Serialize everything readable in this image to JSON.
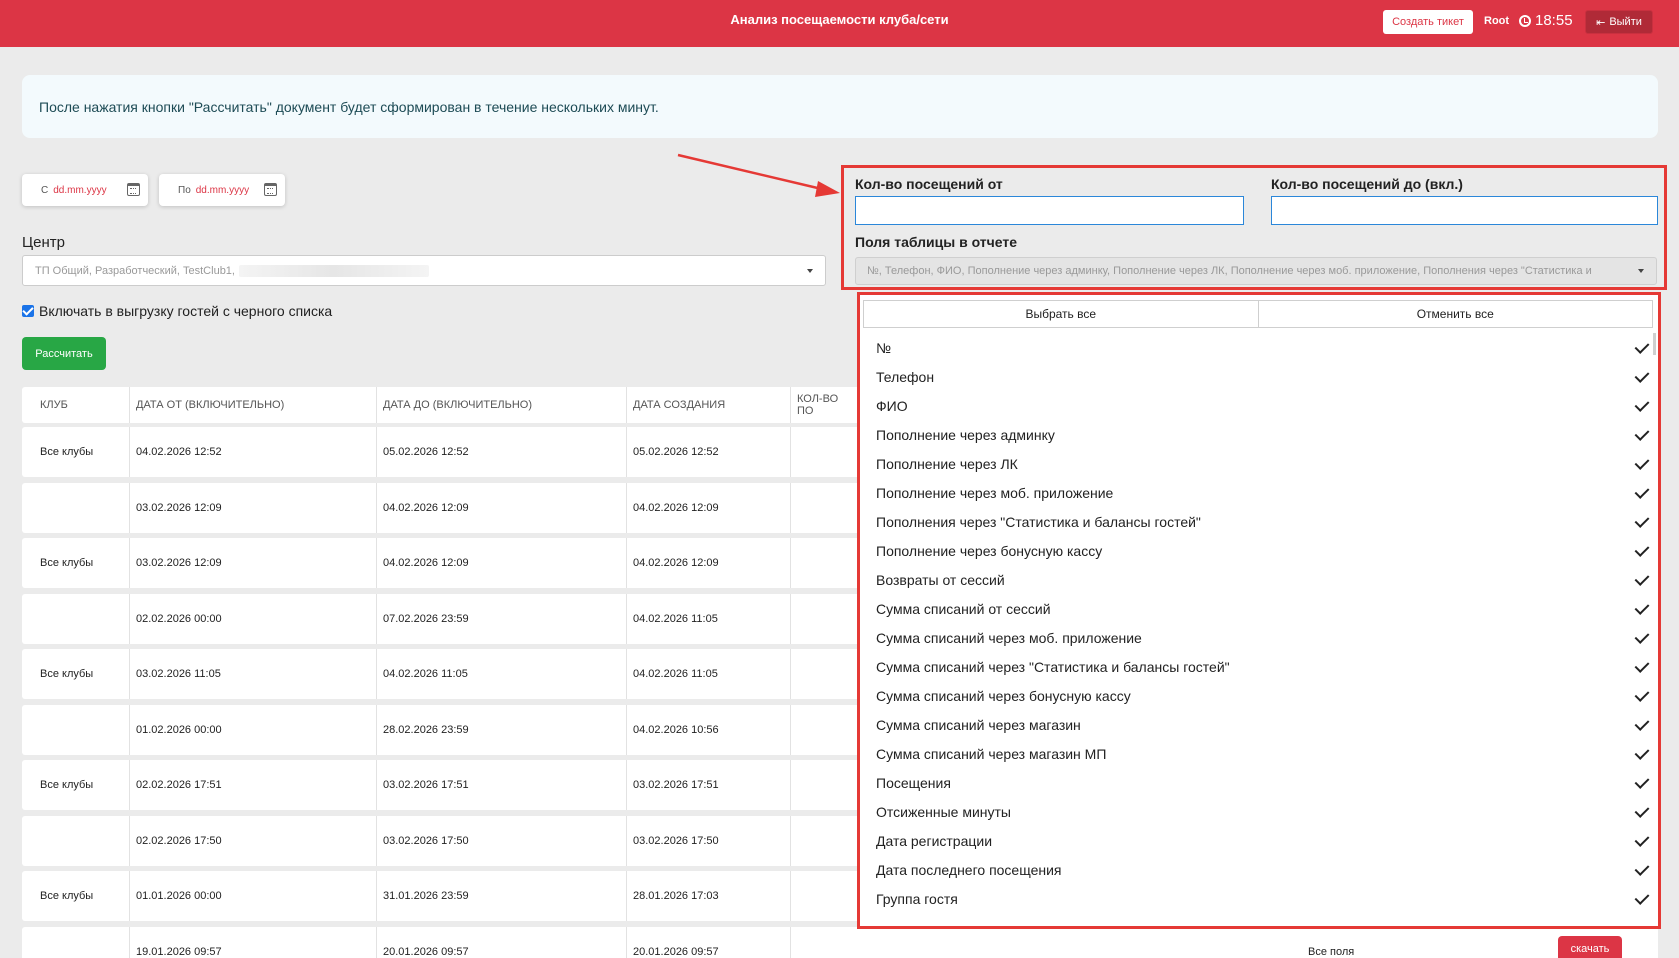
{
  "header": {
    "title": "Анализ посещаемости клуба/сети",
    "create_ticket": "Создать тикет",
    "user": "Root",
    "time": "18:55",
    "logout": "Выйти"
  },
  "info": {
    "message": "После нажатия кнопки \"Рассчитать\" документ будет сформирован в течение нескольких минут."
  },
  "dates": {
    "from_prefix": "С",
    "from_value": "dd.mm.yyyy",
    "to_prefix": "По",
    "to_value": "dd.mm.yyyy"
  },
  "center": {
    "label": "Центр",
    "value": "ТП Общий, Разработческий, TestClub1,"
  },
  "blacklist": {
    "label": "Включать в выгрузку гостей с черного списка"
  },
  "calculate_label": "Рассчитать",
  "visits": {
    "from_label": "Кол-во посещений от",
    "to_label": "Кол-во посещений до (вкл.)",
    "from_value": "",
    "to_value": ""
  },
  "fields": {
    "label": "Поля таблицы в отчете",
    "value": "№, Телефон, ФИО, Пополнение через админку, Пополнение через ЛК, Пополнение через моб. приложение, Пополнения через \"Статистика и",
    "select_all": "Выбрать все",
    "deselect_all": "Отменить все",
    "options": [
      "№",
      "Телефон",
      "ФИО",
      "Пополнение через админку",
      "Пополнение через ЛК",
      "Пополнение через моб. приложение",
      "Пополнения через \"Статистика и балансы гостей\"",
      "Пополнение через бонусную кассу",
      "Возвраты от сессий",
      "Сумма списаний от сессий",
      "Сумма списаний через моб. приложение",
      "Сумма списаний через \"Статистика и балансы гостей\"",
      "Сумма списаний через бонусную кассу",
      "Сумма списаний через магазин",
      "Сумма списаний через магазин МП",
      "Посещения",
      "Отсиженные минуты",
      "Дата регистрации",
      "Дата последнего посещения",
      "Группа гостя"
    ]
  },
  "table": {
    "columns": [
      "КЛУБ",
      "ДАТА ОТ (ВКЛЮЧИТЕЛЬНО)",
      "ДАТА ДО (ВКЛЮЧИТЕЛЬНО)",
      "ДАТА СОЗДАНИЯ",
      "КОЛ-ВО ПО"
    ],
    "rows": [
      [
        "Все клубы",
        "04.02.2026 12:52",
        "05.02.2026 12:52",
        "05.02.2026 12:52"
      ],
      [
        "",
        "03.02.2026 12:09",
        "04.02.2026 12:09",
        "04.02.2026 12:09"
      ],
      [
        "Все клубы",
        "03.02.2026 12:09",
        "04.02.2026 12:09",
        "04.02.2026 12:09"
      ],
      [
        "",
        "02.02.2026 00:00",
        "07.02.2026 23:59",
        "04.02.2026 11:05"
      ],
      [
        "Все клубы",
        "03.02.2026 11:05",
        "04.02.2026 11:05",
        "04.02.2026 11:05"
      ],
      [
        "",
        "01.02.2026 00:00",
        "28.02.2026 23:59",
        "04.02.2026 10:56"
      ],
      [
        "Все клубы",
        "02.02.2026 17:51",
        "03.02.2026 17:51",
        "03.02.2026 17:51"
      ],
      [
        "",
        "02.02.2026 17:50",
        "03.02.2026 17:50",
        "03.02.2026 17:50"
      ],
      [
        "Все клубы",
        "01.01.2026 00:00",
        "31.01.2026 23:59",
        "28.01.2026 17:03"
      ],
      [
        "",
        "19.01.2026 09:57",
        "20.01.2026 09:57",
        "20.01.2026 09:57"
      ]
    ],
    "last_row_fields": "Все поля",
    "download_label": "скачать"
  }
}
